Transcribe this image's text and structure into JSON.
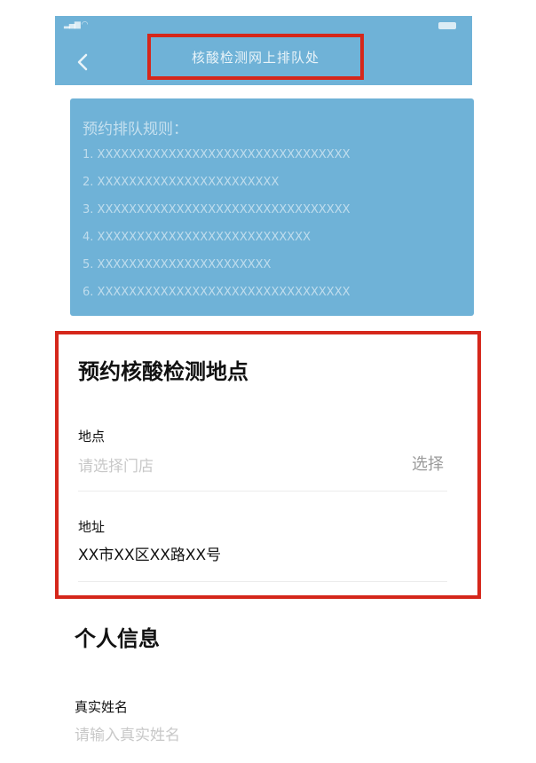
{
  "header": {
    "title": "核酸检测网上排队处",
    "back_icon": "chevron-left-icon"
  },
  "rules": {
    "title": "预约排队规则：",
    "items": [
      "1. XXXXXXXXXXXXXXXXXXXXXXXXXXXXXXXX",
      "2. XXXXXXXXXXXXXXXXXXXXXXX",
      "3. XXXXXXXXXXXXXXXXXXXXXXXXXXXXXXXX",
      "4. XXXXXXXXXXXXXXXXXXXXXXXXXXX",
      "5. XXXXXXXXXXXXXXXXXXXXXX",
      "6. XXXXXXXXXXXXXXXXXXXXXXXXXXXXXXXX"
    ]
  },
  "location_section": {
    "title": "预约核酸检测地点",
    "place_label": "地点",
    "place_placeholder": "请选择门店",
    "select_label": "选择",
    "address_label": "地址",
    "address_value": "XX市XX区XX路XX号"
  },
  "personal_section": {
    "title": "个人信息",
    "name_label": "真实姓名",
    "name_placeholder": "请输入真实姓名"
  },
  "colors": {
    "header_blue": "#6fb2d7",
    "highlight_red": "#d5271b"
  }
}
